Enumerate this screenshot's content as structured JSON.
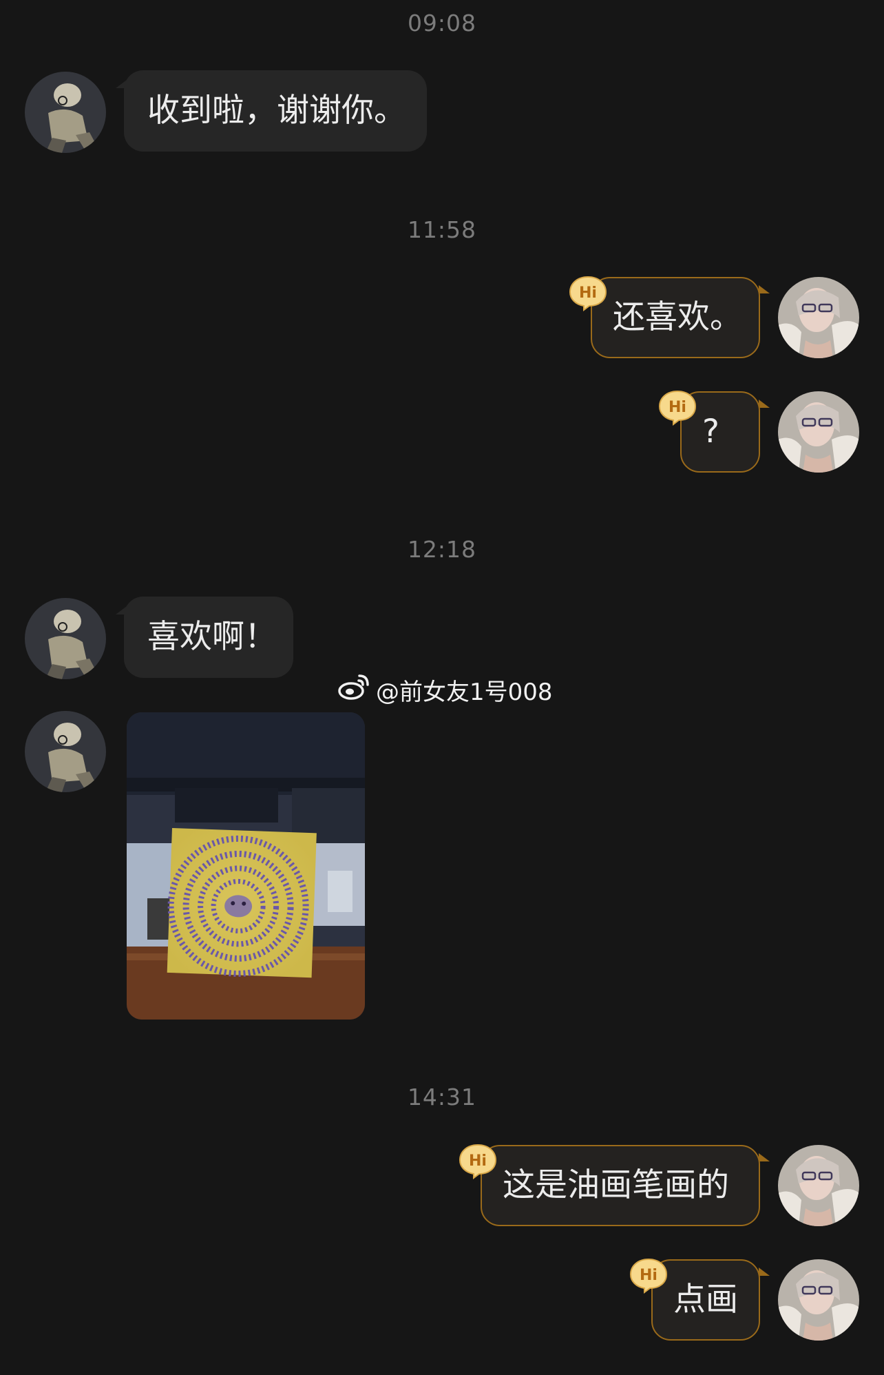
{
  "chat": {
    "timestamps": [
      "09:08",
      "11:58",
      "12:18",
      "14:31"
    ],
    "messages": {
      "m1": "收到啦，谢谢你。",
      "m2": "还喜欢。",
      "m3": "?",
      "m4": "喜欢啊！",
      "m5": "这是油画笔画的",
      "m6": "点画"
    },
    "badge_text": "Hi",
    "watermark": "@前女友1号008"
  },
  "colors": {
    "background": "#161616",
    "incoming_bubble": "#262626",
    "outgoing_bubble_border": "#9a6a1a",
    "badge_fill": "#f7d98c",
    "badge_text": "#b36a12"
  }
}
